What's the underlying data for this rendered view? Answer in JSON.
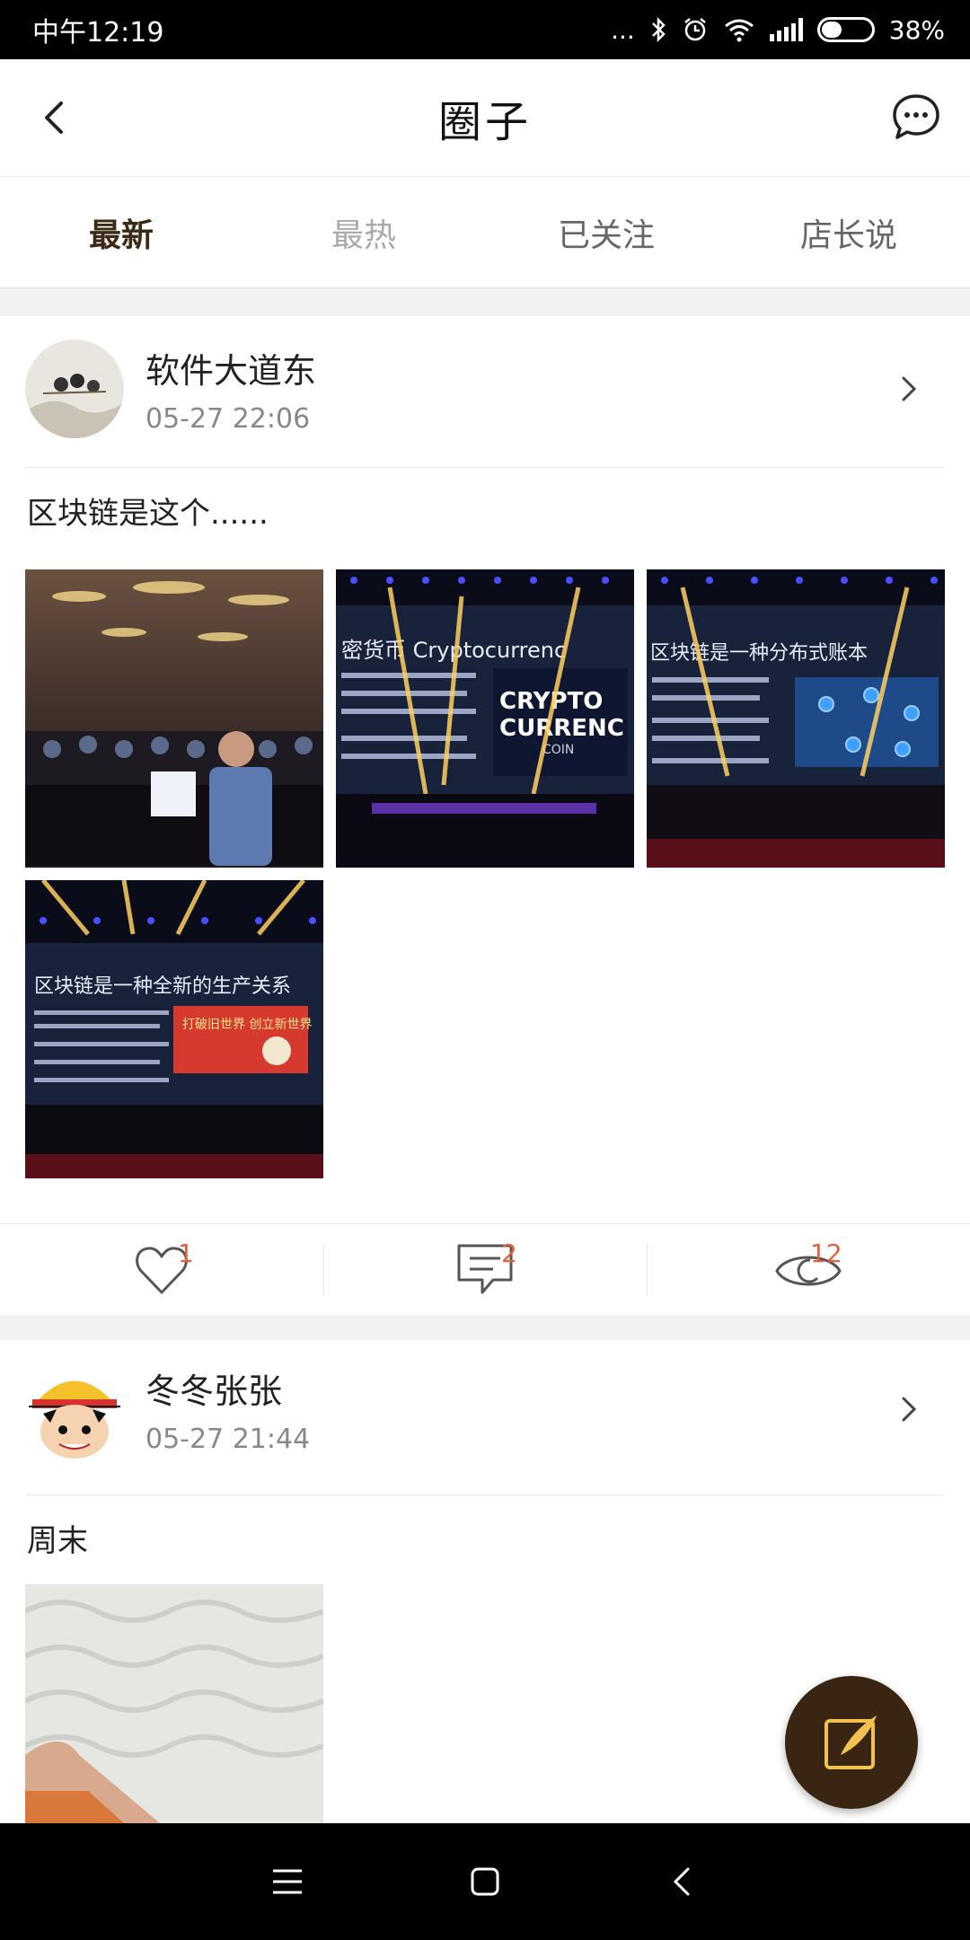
{
  "status": {
    "time": "中午12:19",
    "dots": "...",
    "battery": "38%",
    "battery_level": 0.38
  },
  "header": {
    "title": "圈子"
  },
  "tabs": [
    {
      "label": "最新"
    },
    {
      "label": "最热"
    },
    {
      "label": "已关注"
    },
    {
      "label": "店长说"
    }
  ],
  "posts": [
    {
      "author": "软件大道东",
      "time": "05-27 22:06",
      "text": "区块链是这个......",
      "images": [
        {
          "caption": ""
        },
        {
          "caption": "密货币 Cryptocurrenc",
          "big": "CRYPTO",
          "big2": "CURRENC",
          "small": "COIN"
        },
        {
          "caption": "区块链是一种分布式账本"
        },
        {
          "caption": "区块链是一种全新的生产关系",
          "poster": "打破旧世界 创立新世界"
        }
      ],
      "likes": "1",
      "comments": "2",
      "views": "12"
    },
    {
      "author": "冬冬张张",
      "time": "05-27 21:44",
      "text": "周末"
    }
  ],
  "colors": {
    "accent": "#e0613c",
    "fab": "#3a2412",
    "active_tab": "#3b2a14"
  }
}
